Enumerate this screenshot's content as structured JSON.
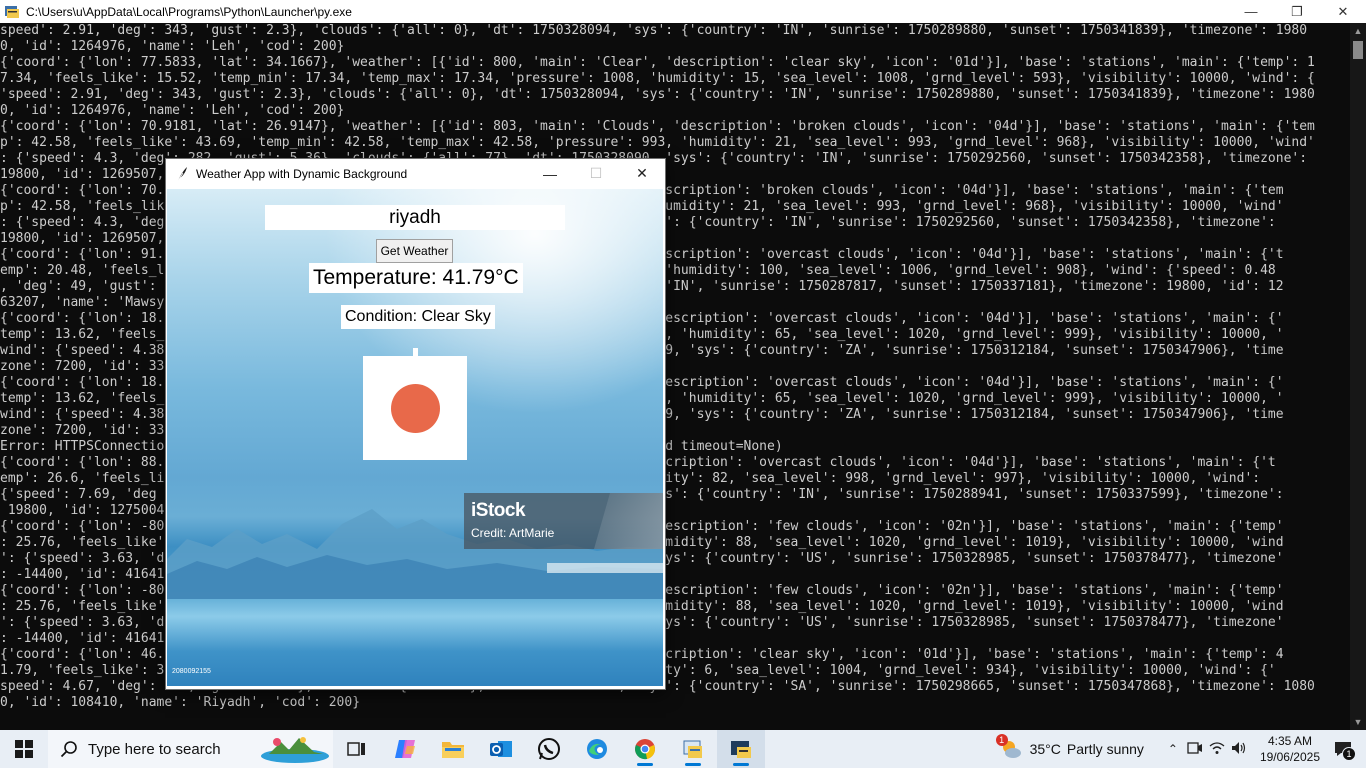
{
  "console": {
    "title": "C:\\Users\\u\\AppData\\Local\\Programs\\Python\\Launcher\\py.exe",
    "lines": [
      "speed': 2.91, 'deg': 343, 'gust': 2.3}, 'clouds': {'all': 0}, 'dt': 1750328094, 'sys': {'country': 'IN', 'sunrise': 1750289880, 'sunset': 1750341839}, 'timezone': 1980",
      "0, 'id': 1264976, 'name': 'Leh', 'cod': 200}",
      "{'coord': {'lon': 77.5833, 'lat': 34.1667}, 'weather': [{'id': 800, 'main': 'Clear', 'description': 'clear sky', 'icon': '01d'}], 'base': 'stations', 'main': {'temp': 1",
      "7.34, 'feels_like': 15.52, 'temp_min': 17.34, 'temp_max': 17.34, 'pressure': 1008, 'humidity': 15, 'sea_level': 1008, 'grnd_level': 593}, 'visibility': 10000, 'wind': {",
      "'speed': 2.91, 'deg': 343, 'gust': 2.3}, 'clouds': {'all': 0}, 'dt': 1750328094, 'sys': {'country': 'IN', 'sunrise': 1750289880, 'sunset': 1750341839}, 'timezone': 1980",
      "0, 'id': 1264976, 'name': 'Leh', 'cod': 200}",
      "{'coord': {'lon': 70.9181, 'lat': 26.9147}, 'weather': [{'id': 803, 'main': 'Clouds', 'description': 'broken clouds', 'icon': '04d'}], 'base': 'stations', 'main': {'tem",
      "p': 42.58, 'feels_like': 43.69, 'temp_min': 42.58, 'temp_max': 42.58, 'pressure': 993, 'humidity': 21, 'sea_level': 993, 'grnd_level': 968}, 'visibility': 10000, 'wind'",
      ": {'speed': 4.3, 'deg': 282, 'gust': 5.36}, 'clouds': {'all': 77}, 'dt': 1750328090, 'sys': {'country': 'IN', 'sunrise': 1750292560, 'sunset': 1750342358}, 'timezone':",
      "19800, 'id': 1269507,",
      "{'coord': {'lon': 70.                                                           , 'description': 'broken clouds', 'icon': '04d'}], 'base': 'stations', 'main': {'tem",
      "p': 42.58, 'feels_lik                                                          93, 'humidity': 21, 'sea_level': 993, 'grnd_level': 968}, 'visibility': 10000, 'wind'",
      ": {'speed': 4.3, 'deg                                                          , 'sys': {'country': 'IN', 'sunrise': 1750292560, 'sunset': 1750342358}, 'timezone':",
      "19800, 'id': 1269507,",
      "{'coord': {'lon': 91.                                                           , 'description': 'overcast clouds', 'icon': '04d'}], 'base': 'stations', 'main': {'t",
      "emp': 20.48, 'feels_l                                                          1006, 'humidity': 100, 'sea_level': 1006, 'grnd_level': 908}, 'wind': {'speed': 0.48",
      ", 'deg': 49, 'gust':                                                           try': 'IN', 'sunrise': 1750287817, 'sunset': 1750337181}, 'timezone': 19800, 'id': 12",
      "63207, 'name': 'Mawsy",
      "{'coord': {'lon': 18.                                                          s', 'description': 'overcast clouds', 'icon': '04d'}], 'base': 'stations', 'main': {'",
      "temp': 13.62, 'feels_                                                          : 1020, 'humidity': 65, 'sea_level': 1020, 'grnd_level': 999}, 'visibility': 10000, '",
      "wind': {'speed': 4.38                                                          0329029, 'sys': {'country': 'ZA', 'sunrise': 1750312184, 'sunset': 1750347906}, 'time",
      "zone': 7200, 'id': 33",
      "{'coord': {'lon': 18.                                                          s', 'description': 'overcast clouds', 'icon': '04d'}], 'base': 'stations', 'main': {'",
      "temp': 13.62, 'feels_                                                          : 1020, 'humidity': 65, 'sea_level': 1020, 'grnd_level': 999}, 'visibility': 10000, '",
      "wind': {'speed': 4.38                                                          0329029, 'sys': {'country': 'ZA', 'sunrise': 1750312184, 'sunset': 1750347906}, 'time",
      "zone': 7200, 'id': 33",
      "Error: HTTPSConnectio                                                          . (read timeout=None)",
      "{'coord': {'lon': 88.                                                          , 'description': 'overcast clouds', 'icon': '04d'}], 'base': 'stations', 'main': {'t",
      "emp': 26.6, 'feels_li                                                           humidity': 82, 'sea_level': 998, 'grnd_level': 997}, 'visibility': 10000, 'wind':",
      "{'speed': 7.69, 'deg                                                           3, 'sys': {'country': 'IN', 'sunrise': 1750288941, 'sunset': 1750337599}, 'timezone':",
      " 19800, 'id': 1275004",
      "{'coord': {'lon': -80                                                          s', 'description': 'few clouds', 'icon': '02n'}], 'base': 'stations', 'main': {'temp'",
      ": 25.76, 'feels_like'                                                          0, 'humidity': 88, 'sea_level': 1020, 'grnd_level': 1019}, 'visibility': 10000, 'wind",
      "': {'speed': 3.63, 'd                                                          40, 'sys': {'country': 'US', 'sunrise': 1750328985, 'sunset': 1750378477}, 'timezone'",
      ": -14400, 'id': 41641",
      "{'coord': {'lon': -80                                                          s', 'description': 'few clouds', 'icon': '02n'}], 'base': 'stations', 'main': {'temp'",
      ": 25.76, 'feels_like'                                                          0, 'humidity': 88, 'sea_level': 1020, 'grnd_level': 1019}, 'visibility': 10000, 'wind",
      "': {'speed': 3.63, 'd                                                          40, 'sys': {'country': 'US', 'sunrise': 1750328985, 'sunset': 1750378477}, 'timezone'",
      ": -14400, 'id': 41641",
      "{'coord': {'lon': 46.                                                          , 'description': 'clear sky', 'icon': '01d'}], 'base': 'stations', 'main': {'temp': 4",
      "1.79, 'feels_like': 3                                                          humidity': 6, 'sea_level': 1004, 'grnd_level': 934}, 'visibility': 10000, 'wind': {'",
      "speed': 4.67, 'deg': 347, 'gust': 5.31}, 'clouds': {'all': 4}, 'dt': 1750329151, 'sys': {'country': 'SA', 'sunrise': 1750298665, 'sunset': 1750347868}, 'timezone': 1080",
      "0, 'id': 108410, 'name': 'Riyadh', 'cod': 200}"
    ]
  },
  "weather_app": {
    "title": "Weather App with Dynamic Background",
    "city_value": "riyadh",
    "button_label": "Get Weather",
    "temperature_text": "Temperature: 41.79°C",
    "condition_text": "Condition: Clear Sky",
    "icon_color": "#e8694a",
    "watermark_logo": "iStock",
    "watermark_credit": "Credit: ArtMarie",
    "photo_id": "2080092155"
  },
  "taskbar": {
    "search_placeholder": "Type here to search",
    "pinned_icons": [
      "task-view-icon",
      "copilot-icon",
      "file-explorer-icon",
      "outlook-icon",
      "whatsapp-icon",
      "edge-icon",
      "chrome-icon",
      "python-idle-icon",
      "python-launcher-icon"
    ],
    "weather_temp": "35°C",
    "weather_desc": "Partly sunny",
    "weather_badge": "1",
    "time": "4:35 AM",
    "date": "19/06/2025",
    "notification_count": "1"
  },
  "colors": {
    "console_bg": "#0c0c0c",
    "console_text": "#cccccc",
    "taskbar_bg": "#e8eef5",
    "accent": "#0078d4"
  }
}
